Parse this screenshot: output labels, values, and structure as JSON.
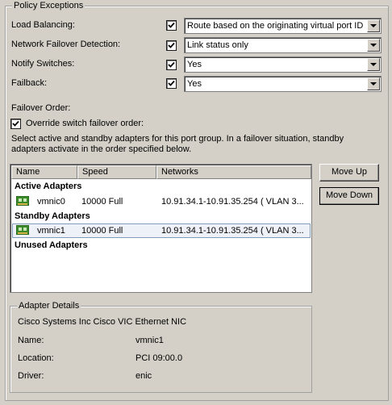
{
  "policy": {
    "title": "Policy Exceptions",
    "load_balancing": {
      "label": "Load Balancing:",
      "checked": true,
      "value": "Route based on the originating virtual port ID"
    },
    "network_failover": {
      "label": "Network Failover Detection:",
      "checked": true,
      "value": "Link status only"
    },
    "notify_switches": {
      "label": "Notify Switches:",
      "checked": true,
      "value": "Yes"
    },
    "failback": {
      "label": "Failback:",
      "checked": true,
      "value": "Yes"
    },
    "failover_order_label": "Failover Order:",
    "override_label": "Override switch failover order:",
    "override_checked": true,
    "description_line1": "Select active and standby adapters for this port group.  In a failover situation, standby",
    "description_line2": "adapters activate  in the order specified below."
  },
  "adapters": {
    "columns": [
      "Name",
      "Speed",
      "Networks"
    ],
    "active_label": "Active Adapters",
    "active": [
      {
        "name": "vmnic0",
        "speed": "10000 Full",
        "networks": "10.91.34.1-10.91.35.254 ( VLAN 3..."
      }
    ],
    "standby_label": "Standby Adapters",
    "standby": [
      {
        "name": "vmnic1",
        "speed": "10000 Full",
        "networks": "10.91.34.1-10.91.35.254 ( VLAN 3...",
        "selected": true
      }
    ],
    "unused_label": "Unused Adapters"
  },
  "buttons": {
    "move_up": "Move Up",
    "move_down": "Move Down"
  },
  "details": {
    "title": "Adapter Details",
    "description": "Cisco Systems Inc Cisco VIC Ethernet NIC",
    "name_label": "Name:",
    "name_value": "vmnic1",
    "location_label": "Location:",
    "location_value": "PCI 09:00.0",
    "driver_label": "Driver:",
    "driver_value": "enic"
  },
  "icons": {
    "checkbox_check": "check-icon",
    "dropdown": "chevron-down-icon",
    "nic": "network-card-icon"
  },
  "colors": {
    "background": "#d4d0c8",
    "nic_green": "#3a8a2a",
    "selection_border": "#7f9db9"
  }
}
